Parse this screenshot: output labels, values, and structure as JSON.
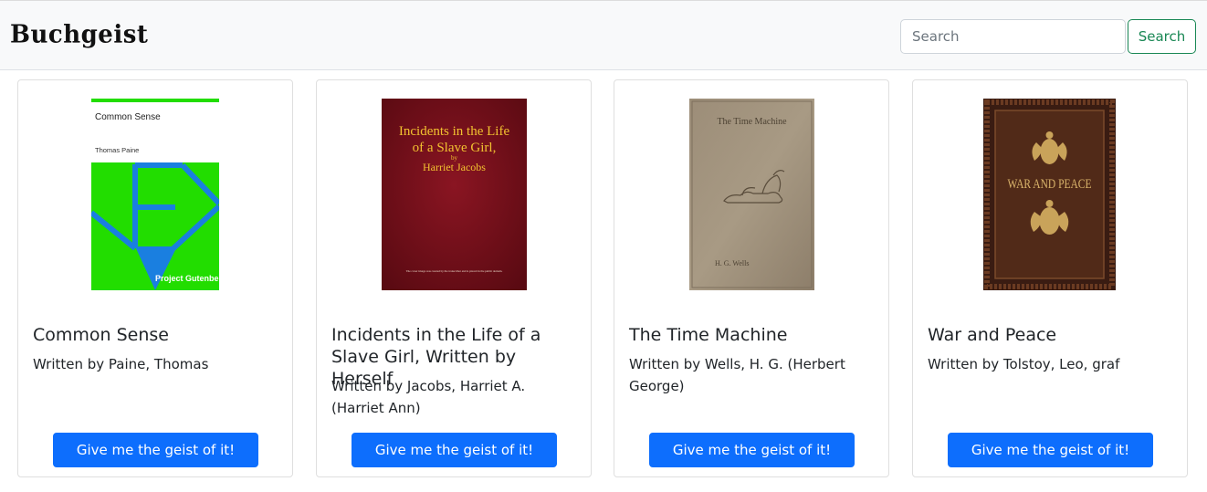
{
  "app": {
    "brand": "Buchgeist"
  },
  "search": {
    "placeholder": "Search",
    "button_label": "Search"
  },
  "books": [
    {
      "title": "Common Sense",
      "author": "Written by Paine, Thomas",
      "button_label": "Give me the geist of it!",
      "cover": {
        "title": "Common Sense",
        "author": "Thomas Paine",
        "publisher": "Project Gutenberg"
      }
    },
    {
      "title": "Incidents in the Life of a Slave Girl, Written by Herself",
      "author": "Written by Jacobs, Harriet A. (Harriet Ann)",
      "button_label": "Give me the geist of it!",
      "cover": {
        "line1": "Incidents in the Life",
        "line2": "of a Slave Girl,",
        "by": "by",
        "author": "Harriet Jacobs",
        "fine_print": "The cover image was created by the transcriber and is placed in the public domain."
      }
    },
    {
      "title": "The Time Machine",
      "author": "Written by Wells, H. G. (Herbert George)",
      "button_label": "Give me the geist of it!",
      "cover": {
        "title": "The Time Machine",
        "author": "H. G. Wells"
      }
    },
    {
      "title": "War and Peace",
      "author": "Written by Tolstoy, Leo, graf",
      "button_label": "Give me the geist of it!",
      "cover": {
        "title": "WAR AND PEACE"
      }
    }
  ]
}
